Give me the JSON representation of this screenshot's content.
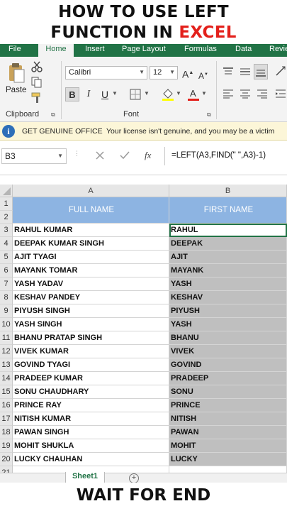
{
  "banner": {
    "line1": "HOW TO USE LEFT",
    "line2_prefix": "FUNCTION IN ",
    "line2_highlight": "EXCEL",
    "bottom": "WAIT FOR END"
  },
  "colors": {
    "excel_green": "#217346",
    "header_fill": "#8db4e2",
    "highlight_red": "#e3201b",
    "selection_gray": "#bfbfbf"
  },
  "ribbon_tabs": [
    "File",
    "Home",
    "Insert",
    "Page Layout",
    "Formulas",
    "Data",
    "Revie"
  ],
  "active_tab": "Home",
  "ribbon": {
    "paste_label": "Paste",
    "font_name": "Calibri",
    "font_size": "12",
    "clipboard_label": "Clipboard",
    "font_label": "Font",
    "bold": "B",
    "italic": "I",
    "underline": "U",
    "grow_font": "A",
    "shrink_font": "A"
  },
  "notice": {
    "title": "GET GENUINE OFFICE",
    "message": "Your license isn't genuine, and you may be a victim"
  },
  "formula_bar": {
    "name_box": "B3",
    "formula": "=LEFT(A3,FIND(\" \",A3)-1)",
    "fx": "fx"
  },
  "columns": [
    "A",
    "B"
  ],
  "headers": {
    "a": "FULL NAME",
    "b": "FIRST NAME"
  },
  "row_numbers": [
    "1",
    "2",
    "3",
    "4",
    "5",
    "6",
    "7",
    "8",
    "9",
    "10",
    "11",
    "12",
    "13",
    "14",
    "15",
    "16",
    "17",
    "18",
    "19",
    "20",
    "21"
  ],
  "rows": [
    {
      "full": "RAHUL KUMAR",
      "first": "RAHUL"
    },
    {
      "full": "DEEPAK KUMAR SINGH",
      "first": "DEEPAK"
    },
    {
      "full": "AJIT TYAGI",
      "first": "AJIT"
    },
    {
      "full": "MAYANK TOMAR",
      "first": "MAYANK"
    },
    {
      "full": "YASH YADAV",
      "first": "YASH"
    },
    {
      "full": "KESHAV PANDEY",
      "first": "KESHAV"
    },
    {
      "full": "PIYUSH SINGH",
      "first": "PIYUSH"
    },
    {
      "full": "YASH SINGH",
      "first": "YASH"
    },
    {
      "full": "BHANU PRATAP SINGH",
      "first": "BHANU"
    },
    {
      "full": "VIVEK KUMAR",
      "first": "VIVEK"
    },
    {
      "full": "GOVIND TYAGI",
      "first": "GOVIND"
    },
    {
      "full": "PRADEEP KUMAR",
      "first": "PRADEEP"
    },
    {
      "full": "SONU CHAUDHARY",
      "first": "SONU"
    },
    {
      "full": "PRINCE RAY",
      "first": "PRINCE"
    },
    {
      "full": "NITISH KUMAR",
      "first": "NITISH"
    },
    {
      "full": "PAWAN SINGH",
      "first": "PAWAN"
    },
    {
      "full": "MOHIT SHUKLA",
      "first": "MOHIT"
    },
    {
      "full": "LUCKY CHAUHAN",
      "first": "LUCKY"
    }
  ],
  "sheet_tab": "Sheet1",
  "icons": [
    "cut-icon",
    "copy-icon",
    "format-painter-icon",
    "paste-icon",
    "borders-icon",
    "fill-color-icon",
    "font-color-icon",
    "align-icon",
    "info-icon",
    "cancel-icon",
    "enter-icon"
  ]
}
